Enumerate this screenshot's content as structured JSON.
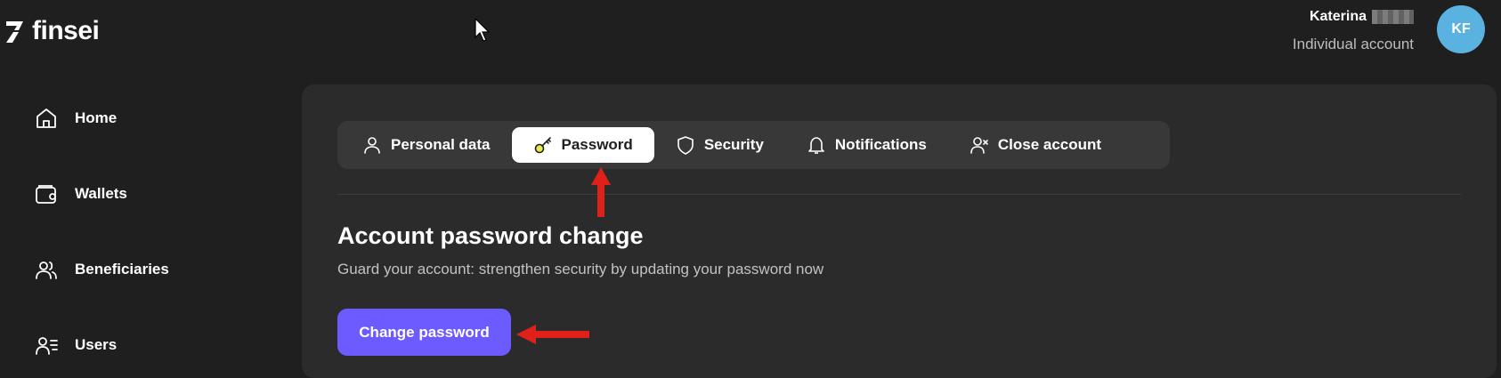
{
  "brand": {
    "name": "finsei",
    "icon": "finsei-logo-mark"
  },
  "account": {
    "name": "Katerina",
    "type": "Individual account",
    "avatar_initials": "KF",
    "avatar_color": "#5ab2e0"
  },
  "sidebar": {
    "items": [
      {
        "label": "Home",
        "icon": "home-icon"
      },
      {
        "label": "Wallets",
        "icon": "wallet-icon"
      },
      {
        "label": "Beneficiaries",
        "icon": "users-icon"
      },
      {
        "label": "Users",
        "icon": "user-list-icon"
      }
    ]
  },
  "tabs": [
    {
      "label": "Personal data",
      "icon": "person-icon",
      "active": false
    },
    {
      "label": "Password",
      "icon": "key-icon",
      "active": true
    },
    {
      "label": "Security",
      "icon": "shield-icon",
      "active": false
    },
    {
      "label": "Notifications",
      "icon": "bell-icon",
      "active": false
    },
    {
      "label": "Close account",
      "icon": "user-remove-icon",
      "active": false
    }
  ],
  "section": {
    "title": "Account password change",
    "subtitle": "Guard your account: strengthen security by updating your password now",
    "button_label": "Change password"
  },
  "colors": {
    "background": "#1f1f1f",
    "panel": "#2b2b2b",
    "tab_bar": "#383838",
    "accent": "#6c5cff",
    "annotation_arrow": "#e0201b"
  }
}
